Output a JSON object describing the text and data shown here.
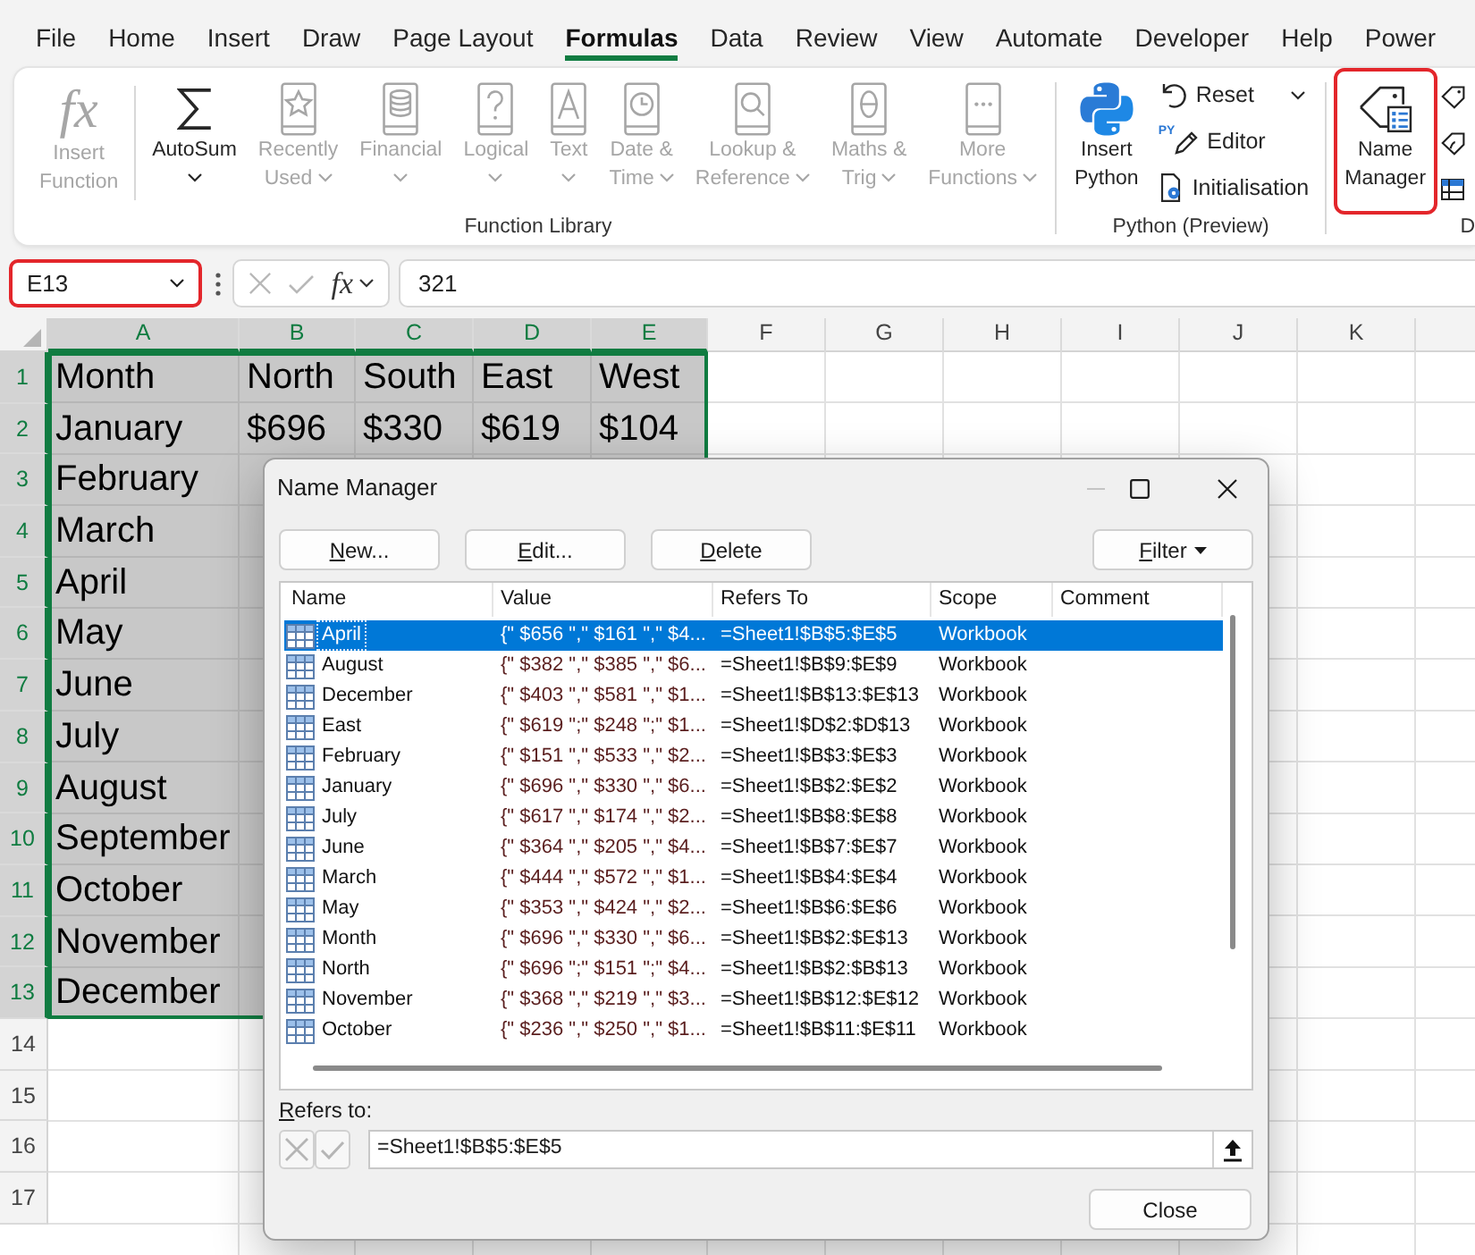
{
  "ribbon_tabs": [
    {
      "label": "File",
      "selected": false
    },
    {
      "label": "Home",
      "selected": false
    },
    {
      "label": "Insert",
      "selected": false
    },
    {
      "label": "Draw",
      "selected": false
    },
    {
      "label": "Page Layout",
      "selected": false
    },
    {
      "label": "Formulas",
      "selected": true
    },
    {
      "label": "Data",
      "selected": false
    },
    {
      "label": "Review",
      "selected": false
    },
    {
      "label": "View",
      "selected": false
    },
    {
      "label": "Automate",
      "selected": false
    },
    {
      "label": "Developer",
      "selected": false
    },
    {
      "label": "Help",
      "selected": false
    },
    {
      "label": "Power",
      "selected": false
    }
  ],
  "ribbon_groups": [
    {
      "label": "Function Library",
      "sections": [
        {
          "buttons": [
            {
              "kind": "large",
              "glyph": "fx",
              "label": "Insert\nFunction",
              "disabled": true,
              "dropdown": false,
              "highlighted": false
            }
          ]
        },
        {
          "buttons": [
            {
              "kind": "large",
              "label": "AutoSum",
              "disabled": false,
              "dropdown": true,
              "highlighted": false
            },
            {
              "kind": "large",
              "label": "Recently\nUsed",
              "disabled": true,
              "dropdown": true,
              "highlighted": false
            },
            {
              "kind": "large",
              "label": "Financial",
              "disabled": true,
              "dropdown": true,
              "highlighted": false
            },
            {
              "kind": "large",
              "label": "Logical",
              "disabled": true,
              "dropdown": true,
              "highlighted": false
            },
            {
              "kind": "large",
              "label": "Text",
              "disabled": true,
              "dropdown": true,
              "highlighted": false
            },
            {
              "kind": "large",
              "label": "Date &\nTime",
              "disabled": true,
              "dropdown": true,
              "highlighted": false
            },
            {
              "kind": "large",
              "label": "Lookup &\nReference",
              "disabled": true,
              "dropdown": true,
              "highlighted": false
            },
            {
              "kind": "large",
              "label": "Maths &\nTrig",
              "disabled": true,
              "dropdown": true,
              "highlighted": false
            },
            {
              "kind": "large",
              "label": "More\nFunctions",
              "disabled": true,
              "dropdown": true,
              "highlighted": false
            }
          ]
        }
      ]
    },
    {
      "label": "Python (Preview)",
      "sections": [
        {
          "buttons": [
            {
              "kind": "large",
              "label": "Insert\nPython",
              "disabled": false,
              "dropdown": false,
              "highlighted": false
            },
            {
              "kind": "small",
              "label": "Reset",
              "disabled": false,
              "dropdown": true,
              "highlighted": false
            },
            {
              "kind": "small",
              "glyph": "PY",
              "label": "Editor",
              "disabled": false,
              "dropdown": false,
              "highlighted": false
            },
            {
              "kind": "small",
              "label": "Initialisation",
              "disabled": false,
              "dropdown": false,
              "highlighted": false
            }
          ]
        }
      ]
    },
    {
      "label": "D",
      "sections": [
        {
          "buttons": [
            {
              "kind": "large",
              "label": "Name\nManager",
              "disabled": false,
              "dropdown": false,
              "highlighted": true
            },
            {
              "kind": "icon"
            },
            {
              "kind": "icon"
            },
            {
              "kind": "icon"
            }
          ]
        }
      ]
    }
  ],
  "name_box": {
    "value": "E13",
    "highlighted": true
  },
  "formula_buttons": [
    {
      "kind": "cancel",
      "disabled": true
    },
    {
      "kind": "enter",
      "disabled": true
    },
    {
      "kind": "function",
      "glyph": "fx",
      "disabled": false
    }
  ],
  "formula": "321",
  "sheet": {
    "columns": [
      {
        "label": "A",
        "selected": true
      },
      {
        "label": "B",
        "selected": true
      },
      {
        "label": "C",
        "selected": true
      },
      {
        "label": "D",
        "selected": true
      },
      {
        "label": "E",
        "selected": true
      },
      {
        "label": "F",
        "selected": false
      },
      {
        "label": "G",
        "selected": false
      },
      {
        "label": "H",
        "selected": false
      },
      {
        "label": "I",
        "selected": false
      },
      {
        "label": "J",
        "selected": false
      },
      {
        "label": "K",
        "selected": false
      }
    ],
    "rows": [
      {
        "label": "1",
        "selected": true,
        "cells": [
          "Month",
          "North",
          "South",
          "East",
          "West"
        ]
      },
      {
        "label": "2",
        "selected": true,
        "cells": [
          "January",
          "$696",
          "$330",
          "$619",
          "$104"
        ]
      },
      {
        "label": "3",
        "selected": true,
        "cells": [
          "February"
        ]
      },
      {
        "label": "4",
        "selected": true,
        "cells": [
          "March"
        ]
      },
      {
        "label": "5",
        "selected": true,
        "cells": [
          "April"
        ]
      },
      {
        "label": "6",
        "selected": true,
        "cells": [
          "May"
        ]
      },
      {
        "label": "7",
        "selected": true,
        "cells": [
          "June"
        ]
      },
      {
        "label": "8",
        "selected": true,
        "cells": [
          "July"
        ]
      },
      {
        "label": "9",
        "selected": true,
        "cells": [
          "August"
        ]
      },
      {
        "label": "10",
        "selected": true,
        "cells": [
          "September"
        ]
      },
      {
        "label": "11",
        "selected": true,
        "cells": [
          "October"
        ]
      },
      {
        "label": "12",
        "selected": true,
        "cells": [
          "November"
        ]
      },
      {
        "label": "13",
        "selected": true,
        "cells": [
          "December"
        ]
      },
      {
        "label": "14",
        "selected": false
      },
      {
        "label": "15",
        "selected": false
      },
      {
        "label": "16",
        "selected": false
      },
      {
        "label": "17",
        "selected": false
      }
    ]
  },
  "dialog": {
    "title": "Name Manager",
    "window_controls": [
      {
        "kind": "minimize",
        "disabled": true
      },
      {
        "kind": "maximize",
        "disabled": false
      },
      {
        "kind": "close",
        "disabled": false
      }
    ],
    "buttons": [
      "New...",
      "Edit...",
      "Delete"
    ],
    "filter_button": "Filter",
    "columns": [
      "Name",
      "Value",
      "Refers To",
      "Scope",
      "Comment"
    ],
    "rows": [
      {
        "name": "April",
        "value": "{\" $656 \",\" $161 \",\" $4...",
        "refers_to": "=Sheet1!$B$5:$E$5",
        "scope": "Workbook",
        "selected": true
      },
      {
        "name": "August",
        "value": "{\" $382 \",\" $385 \",\" $6...",
        "refers_to": "=Sheet1!$B$9:$E$9",
        "scope": "Workbook",
        "selected": false
      },
      {
        "name": "December",
        "value": "{\" $403 \",\" $581 \",\" $1...",
        "refers_to": "=Sheet1!$B$13:$E$13",
        "scope": "Workbook",
        "selected": false
      },
      {
        "name": "East",
        "value": "{\" $619 \";\" $248 \";\" $1...",
        "refers_to": "=Sheet1!$D$2:$D$13",
        "scope": "Workbook",
        "selected": false
      },
      {
        "name": "February",
        "value": "{\" $151 \",\" $533 \",\" $2...",
        "refers_to": "=Sheet1!$B$3:$E$3",
        "scope": "Workbook",
        "selected": false
      },
      {
        "name": "January",
        "value": "{\" $696 \",\" $330 \",\" $6...",
        "refers_to": "=Sheet1!$B$2:$E$2",
        "scope": "Workbook",
        "selected": false
      },
      {
        "name": "July",
        "value": "{\" $617 \",\" $174 \",\" $2...",
        "refers_to": "=Sheet1!$B$8:$E$8",
        "scope": "Workbook",
        "selected": false
      },
      {
        "name": "June",
        "value": "{\" $364 \",\" $205 \",\" $4...",
        "refers_to": "=Sheet1!$B$7:$E$7",
        "scope": "Workbook",
        "selected": false
      },
      {
        "name": "March",
        "value": "{\" $444 \",\" $572 \",\" $1...",
        "refers_to": "=Sheet1!$B$4:$E$4",
        "scope": "Workbook",
        "selected": false
      },
      {
        "name": "May",
        "value": "{\" $353 \",\" $424 \",\" $2...",
        "refers_to": "=Sheet1!$B$6:$E$6",
        "scope": "Workbook",
        "selected": false
      },
      {
        "name": "Month",
        "value": "{\" $696 \",\" $330 \",\" $6...",
        "refers_to": "=Sheet1!$B$2:$E$13",
        "scope": "Workbook",
        "selected": false
      },
      {
        "name": "North",
        "value": "{\" $696 \";\" $151 \";\" $4...",
        "refers_to": "=Sheet1!$B$2:$B$13",
        "scope": "Workbook",
        "selected": false
      },
      {
        "name": "November",
        "value": "{\" $368 \",\" $219 \",\" $3...",
        "refers_to": "=Sheet1!$B$12:$E$12",
        "scope": "Workbook",
        "selected": false
      },
      {
        "name": "October",
        "value": "{\" $236 \",\" $250 \",\" $1...",
        "refers_to": "=Sheet1!$B$11:$E$11",
        "scope": "Workbook",
        "selected": false
      }
    ],
    "refers_to_label": "Refers to:",
    "refers_to_buttons": [
      {
        "kind": "cancel",
        "disabled": true
      },
      {
        "kind": "enter",
        "disabled": true
      }
    ],
    "refers_to_value": "=Sheet1!$B$5:$E$5",
    "close_button": "Close"
  }
}
